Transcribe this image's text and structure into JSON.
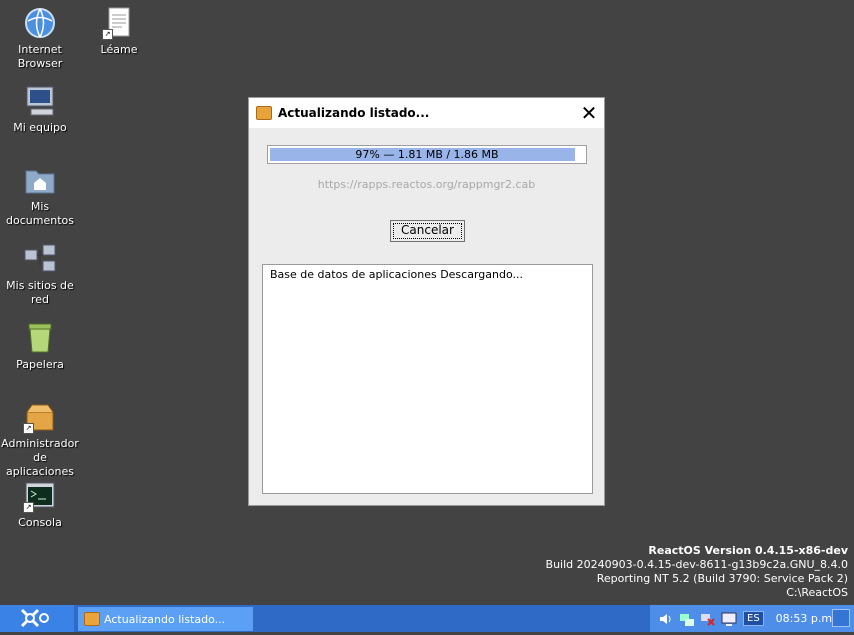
{
  "desktop": {
    "icons": [
      {
        "label": "Internet\nBrowser"
      },
      {
        "label": "Léame"
      },
      {
        "label": "Mi equipo"
      },
      {
        "label": "Mis\ndocumentos"
      },
      {
        "label": "Mis sitios de\nred"
      },
      {
        "label": "Papelera"
      },
      {
        "label": "Administrador\nde aplicaciones"
      },
      {
        "label": "Consola"
      }
    ]
  },
  "dialog": {
    "title": "Actualizando listado...",
    "progress_text": "97% — 1.81 MB / 1.86 MB",
    "progress_value": 0.97,
    "url": "https://rapps.reactos.org/rappmgr2.cab",
    "cancel_label": "Cancelar",
    "log_text": "Base de datos de aplicaciones  Descargando..."
  },
  "version_info": {
    "line1": "ReactOS Version 0.4.15-x86-dev",
    "line2": "Build 20240903-0.4.15-dev-8611-g13b9c2a.GNU_8.4.0",
    "line3": "Reporting NT 5.2 (Build 3790: Service Pack 2)",
    "line4": "C:\\ReactOS"
  },
  "taskbar": {
    "task_label": "Actualizando listado...",
    "language": "ES",
    "clock": "08:53 p.m."
  },
  "colors": {
    "desktop_bg": "#434343",
    "taskbar": "#2f6bc6",
    "progress_fill": "#99b4e8"
  }
}
